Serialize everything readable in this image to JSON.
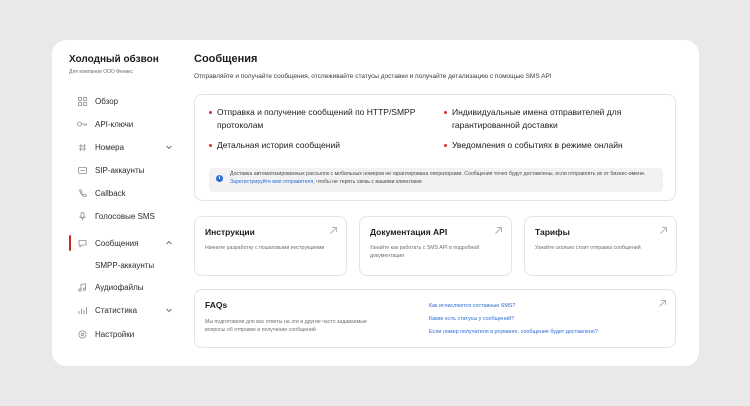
{
  "sidebar": {
    "company": "Холодный обзвон",
    "company_sub": "Для компании ООО Феникс",
    "items": [
      {
        "label": "Обзор",
        "icon": "grid-icon"
      },
      {
        "label": "API-ключи",
        "icon": "key-icon"
      },
      {
        "label": "Номера",
        "icon": "hash-icon"
      },
      {
        "label": "SIP-аккаунты",
        "icon": "sip-icon"
      },
      {
        "label": "Callback",
        "icon": "phone-icon"
      },
      {
        "label": "Голосовые SMS",
        "icon": "voice-icon"
      },
      {
        "label": "Сообщения",
        "icon": "message-icon"
      },
      {
        "label": "SMPP-аккаунты",
        "icon": ""
      },
      {
        "label": "Аудиофайлы",
        "icon": "audio-icon"
      },
      {
        "label": "Статистика",
        "icon": "chart-icon"
      },
      {
        "label": "Настройки",
        "icon": "settings-icon"
      }
    ]
  },
  "main": {
    "title": "Сообщения",
    "subtitle": "Отправляйте и получайте сообщения, отслеживайте статусы доставки и получайте детализацию с помощью SMS API",
    "features": [
      "Отправка и получение сообщений по HTTP/SMPP протоколам",
      "Детальная история сообщений",
      "Индивидуальные имена отправителей для гарантированной доставки",
      "Уведомления о событиях в режиме онлайн"
    ],
    "notice": {
      "text_before": "Доставка автоматизированных рассылок с мобильных номеров не гарантирована операторами. Сообщения точно будут доставлены, если отправлять их от бизнес-имени. ",
      "link": "Зарегистрируйте имя отправителя",
      "text_after": ", чтобы не терять связь с вашими клиентами"
    },
    "tiles": [
      {
        "title": "Инструкции",
        "desc": "Начните разработку с пошаговыми инструкциями"
      },
      {
        "title": "Документация API",
        "desc": "Узнайте как работать с SMS API в подробной документации"
      },
      {
        "title": "Тарифы",
        "desc": "Узнайте сколько стоит отправка сообщений"
      }
    ],
    "faq": {
      "title": "FAQs",
      "desc": "Мы подготовили для вас ответы на эти и другие часто задаваемые вопросы об отправке и получении сообщений",
      "links": [
        "Как исчисляются составные SMS?",
        "Какие есть статусы у сообщений?",
        "Если номер получателя в роуминге, сообщение будет доставлено?"
      ]
    }
  },
  "colors": {
    "accent": "#d32f2f",
    "link": "#2b6cd4",
    "background": "#e9e9eb"
  }
}
